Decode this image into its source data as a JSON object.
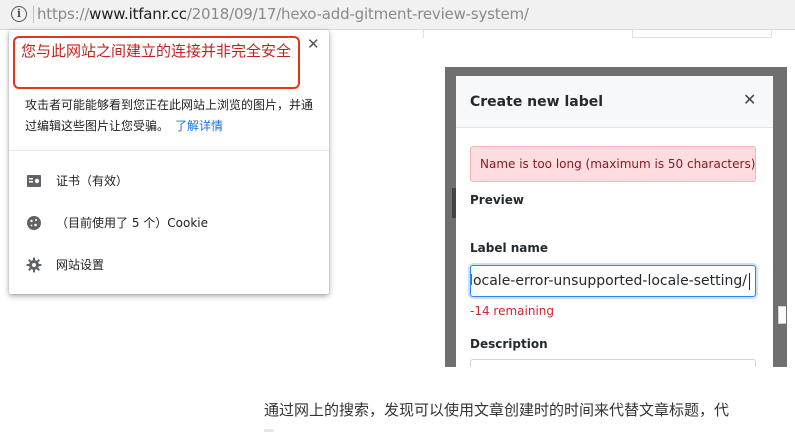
{
  "address_bar": {
    "url_scheme": "https://",
    "url_host": "www.itfanr.cc",
    "url_path": "/2018/09/17/hexo-add-gitment-review-system/"
  },
  "site_info_popup": {
    "warning_title": "您与此网站之间建立的连接并非完全安全",
    "warning_body": "攻击者可能能够看到您正在此网站上浏览的图片，并通过编辑这些图片让您受骗。",
    "learn_more": "了解详情",
    "rows": [
      {
        "icon": "certificate-icon",
        "label": "证书（有效）"
      },
      {
        "icon": "cookie-icon",
        "label": "（目前使用了 5 个）Cookie"
      },
      {
        "icon": "gear-icon",
        "label": "网站设置"
      }
    ]
  },
  "embedded_screenshot": {
    "modal_title": "Create new label",
    "error_message": "Name is too long (maximum is 50 characters)",
    "preview_label": "Preview",
    "label_name_label": "Label name",
    "label_name_value": "-locale-error-unsupported-locale-setting/",
    "remaining": "-14 remaining",
    "description_label": "Description"
  },
  "article": {
    "paragraph": "通过网上的搜索，发现可以使用文章创建时的时间来代替文章标题，代"
  },
  "colors": {
    "warning_red": "#c5221f",
    "warning_border": "#e53517",
    "link_blue": "#1a73e8",
    "error_bg": "#ffdce0",
    "error_text": "#86181d",
    "input_focus": "#2188ff"
  }
}
